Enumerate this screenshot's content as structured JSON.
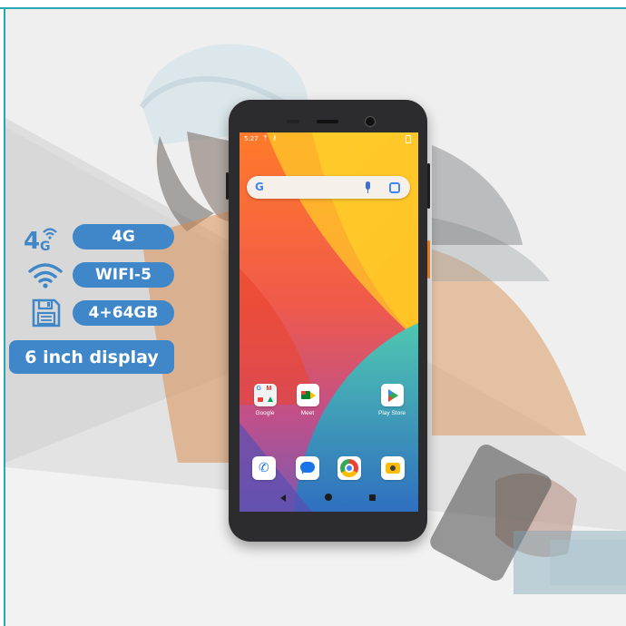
{
  "specs": [
    {
      "icon": "4g-signal-icon",
      "icon_text": "4G",
      "label": "4G"
    },
    {
      "icon": "wifi-icon",
      "label": "WIFI-5"
    },
    {
      "icon": "floppy-disk-icon",
      "label": "4+64GB"
    },
    {
      "label": "6 inch display"
    }
  ],
  "phone": {
    "status_time": "5:27",
    "apps": [
      {
        "label": "Google",
        "icon": "google-apps-folder-icon"
      },
      {
        "label": "Meet",
        "icon": "meet-icon"
      },
      {
        "label": "Play Store",
        "icon": "play-store-icon"
      }
    ],
    "dock": [
      "phone-icon",
      "messages-icon",
      "chrome-icon",
      "camera-icon"
    ]
  },
  "colors": {
    "accent": "#3f87c9",
    "frame": "#2aa7b3",
    "background": "#efefef",
    "phone_body": "#2c2c2e"
  }
}
